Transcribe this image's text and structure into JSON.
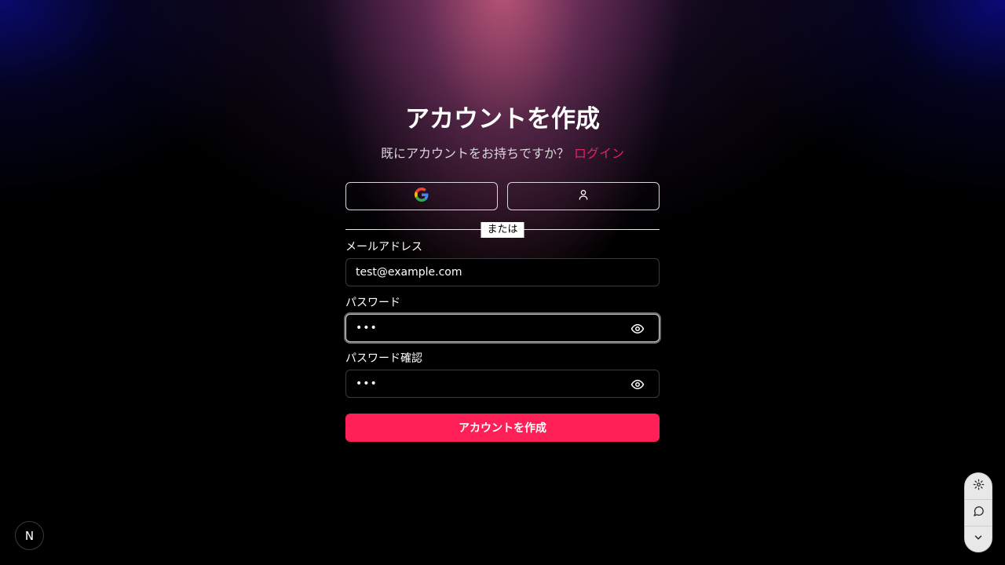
{
  "page": {
    "title": "アカウントを作成",
    "subtitle_text": "既にアカウントをお持ちですか？",
    "login_link": "ログイン"
  },
  "social": {
    "google_icon": "google-icon",
    "guest_icon": "person-icon"
  },
  "divider_text": "または",
  "fields": {
    "email": {
      "label": "メールアドレス",
      "value": "test@example.com"
    },
    "password": {
      "label": "パスワード",
      "value_masked": "•••"
    },
    "password_confirm": {
      "label": "パスワード確認",
      "value_masked": "•••"
    }
  },
  "submit_label": "アカウントを作成",
  "badge_letter": "N",
  "colors": {
    "accent": "#ff1f57",
    "link": "#e0245e"
  },
  "dock_icons": [
    "gear-icon",
    "chat-bubble-icon",
    "chevron-down-icon"
  ]
}
